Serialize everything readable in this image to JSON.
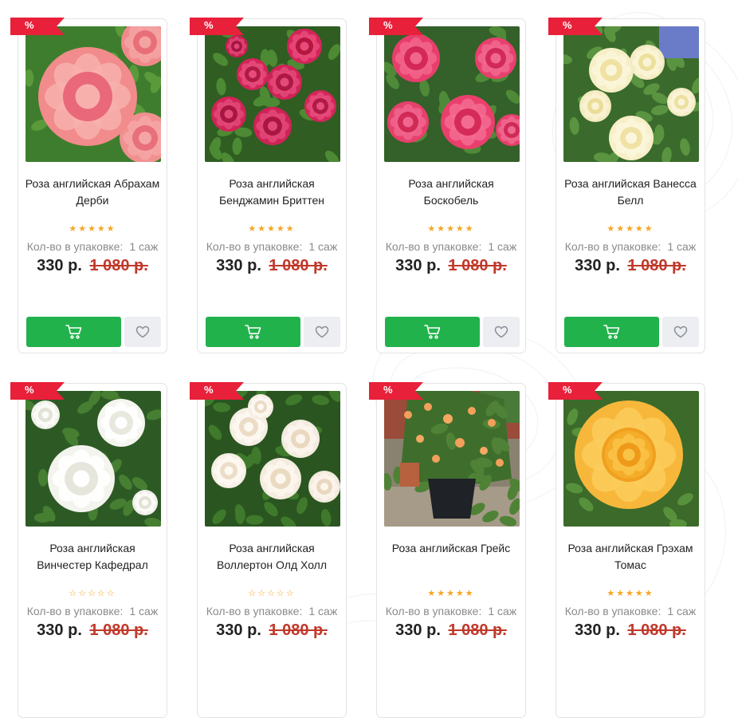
{
  "badge_label": "%",
  "pack_label": "Кол-во в упаковке:",
  "icons": {
    "cart": "cart-icon",
    "favorite": "heart-icon",
    "badge": "sale-ribbon"
  },
  "colors": {
    "accent_green": "#22b24c",
    "ribbon_red": "#e8203a",
    "old_price": "#c0392b",
    "star": "#f5a623"
  },
  "products": [
    {
      "name": "Роза английская Абрахам Дерби",
      "rating": 5,
      "qty": "1 саж",
      "price": "330 р.",
      "old_price": "1 080 р."
    },
    {
      "name": "Роза английская Бенджамин Бриттен",
      "rating": 5,
      "qty": "1 саж",
      "price": "330 р.",
      "old_price": "1 080 р."
    },
    {
      "name": "Роза английская Боскобель",
      "rating": 5,
      "qty": "1 саж",
      "price": "330 р.",
      "old_price": "1 080 р."
    },
    {
      "name": "Роза английская Ванесса Белл",
      "rating": 5,
      "qty": "1 саж",
      "price": "330 р.",
      "old_price": "1 080 р."
    },
    {
      "name": "Роза английская Винчестер Кафедрал",
      "rating": 0,
      "qty": "1 саж",
      "price": "330 р.",
      "old_price": "1 080 р."
    },
    {
      "name": "Роза английская Воллертон Олд Холл",
      "rating": 0,
      "qty": "1 саж",
      "price": "330 р.",
      "old_price": "1 080 р."
    },
    {
      "name": "Роза английская Грейс",
      "rating": 5,
      "qty": "1 саж",
      "price": "330 р.",
      "old_price": "1 080 р."
    },
    {
      "name": "Роза английская Грэхам Томас",
      "rating": 5,
      "qty": "1 саж",
      "price": "330 р.",
      "old_price": "1 080 р."
    }
  ]
}
